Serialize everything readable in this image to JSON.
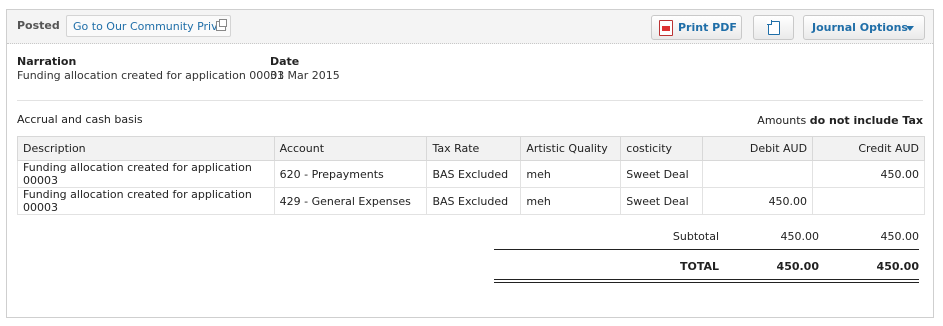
{
  "toolbar": {
    "status": "Posted",
    "community_link": "Go to Our Community Priv...",
    "print_pdf": "Print PDF",
    "journal_options": "Journal Options"
  },
  "header": {
    "narration_label": "Narration",
    "narration_value": "Funding allocation created for application 00003",
    "date_label": "Date",
    "date_value": "31 Mar 2015"
  },
  "basis": {
    "text": "Accrual and cash basis",
    "amounts_prefix": "Amounts",
    "amounts_suffix": "do not include Tax"
  },
  "table": {
    "columns": [
      "Description",
      "Account",
      "Tax Rate",
      "Artistic Quality",
      "costicity",
      "Debit AUD",
      "Credit AUD"
    ],
    "rows": [
      [
        "Funding allocation created for application 00003",
        "620 - Prepayments",
        "BAS Excluded",
        "meh",
        "Sweet Deal",
        "",
        "450.00"
      ],
      [
        "Funding allocation created for application 00003",
        "429 - General Expenses",
        "BAS Excluded",
        "meh",
        "Sweet Deal",
        "450.00",
        ""
      ]
    ]
  },
  "totals": {
    "subtotal_label": "Subtotal",
    "subtotal_debit": "450.00",
    "subtotal_credit": "450.00",
    "total_label": "TOTAL",
    "total_debit": "450.00",
    "total_credit": "450.00"
  },
  "icons": {
    "external": "external-link-icon",
    "pdf": "pdf-icon",
    "copy": "copy-icon",
    "caret": "chevron-down-icon"
  }
}
